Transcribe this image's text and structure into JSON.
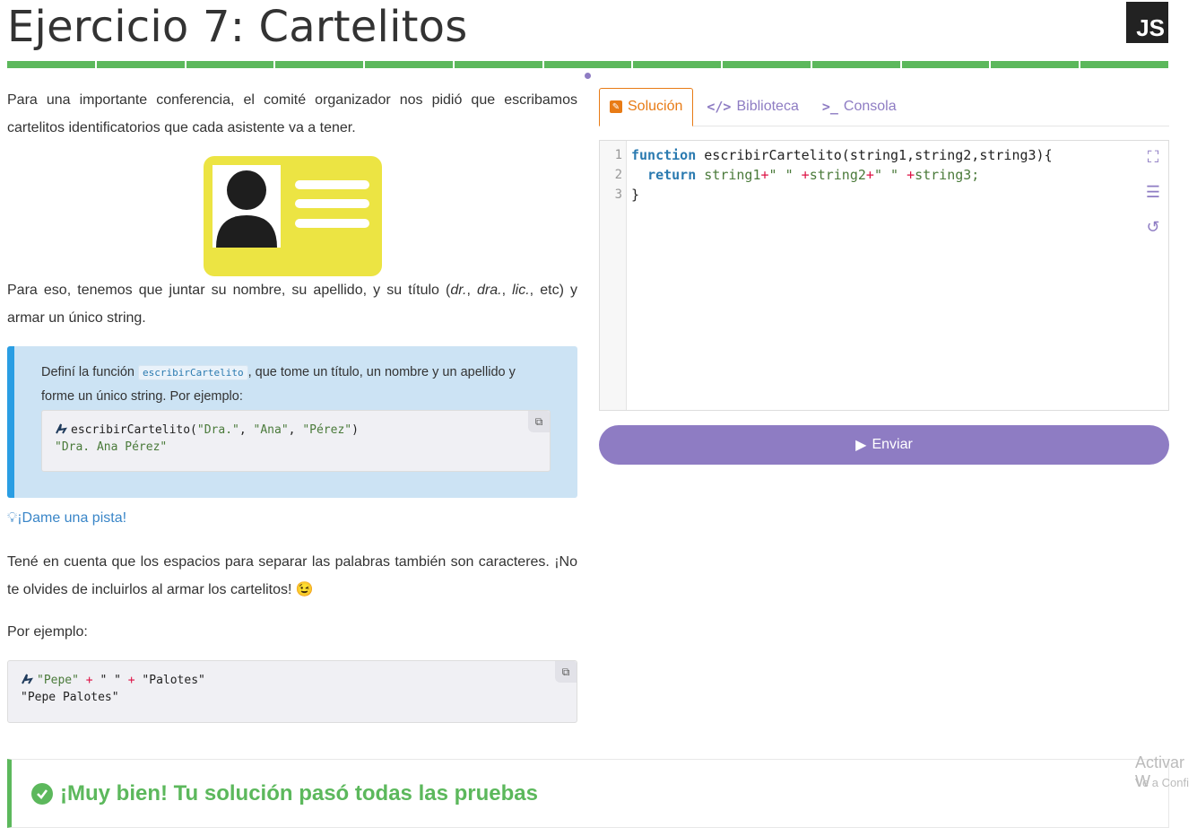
{
  "header": {
    "title": "Ejercicio 7: Cartelitos",
    "language_badge": "JS",
    "progress_segments": 13,
    "progress_color": "#5cb85c"
  },
  "statement": {
    "p1": "Para una importante conferencia, el comité organizador nos pidió que escribamos cartelitos identificatorios que cada asistente va a tener.",
    "p2_before": "Para eso, tenemos que juntar su nombre, su apellido, y su título (",
    "p2_t1": "dr.",
    "p2_sep1": ", ",
    "p2_t2": "dra.",
    "p2_sep2": ", ",
    "p2_t3": "lic.",
    "p2_after": ", etc) y armar un único string.",
    "task_before": "Definí la función ",
    "task_code": "escribirCartelito",
    "task_after": ", que tome un título, un nombre y un apellido y forme un único string. Por ejemplo:",
    "task_example": {
      "fn": "escribirCartelito(",
      "arg1": "\"Dra.\"",
      "comma1": ", ",
      "arg2": "\"Ana\"",
      "comma2": ", ",
      "arg3": "\"Pérez\"",
      "close": ")",
      "result": "\"Dra. Ana Pérez\""
    },
    "hint": "¡Dame una pista!",
    "note": "Tené en cuenta que los espacios para separar las palabras también son caracteres. ¡No te olvides de incluirlos al armar los cartelitos!",
    "note_emoji": "😉",
    "example_label": "Por ejemplo:",
    "example": {
      "s1": "\"Pepe\"",
      "plus1": " + ",
      "s2": "\" \"",
      "plus2": " + ",
      "s3": "\"Palotes\"",
      "result": "\"Pepe Palotes\""
    }
  },
  "editor": {
    "tabs": [
      {
        "label": "Solución",
        "icon": "pencil-icon",
        "active": true
      },
      {
        "label": "Biblioteca",
        "icon": "code-icon",
        "active": false
      },
      {
        "label": "Consola",
        "icon": "terminal-icon",
        "active": false
      }
    ],
    "line_numbers": [
      "1",
      "2",
      "3"
    ],
    "code": {
      "l1_kw": "function",
      "l1_rest": " escribirCartelito(string1,string2,string3){",
      "l2_indent": "  ",
      "l2_kw": "return",
      "l2_a": " string1",
      "l2_op1": "+",
      "l2_s1": "\" \"",
      "l2_op2": "+",
      "l2_b": "string2",
      "l2_op3": "+",
      "l2_s2": "\" \"",
      "l2_op4": "+",
      "l2_c": "string3;",
      "l3": "}"
    },
    "submit_label": "Enviar"
  },
  "result": {
    "message": "¡Muy bien! Tu solución pasó todas las pruebas",
    "status_color": "#5cb85c"
  },
  "watermark": {
    "line1": "Activar W",
    "line2": "Ve a Confi"
  }
}
